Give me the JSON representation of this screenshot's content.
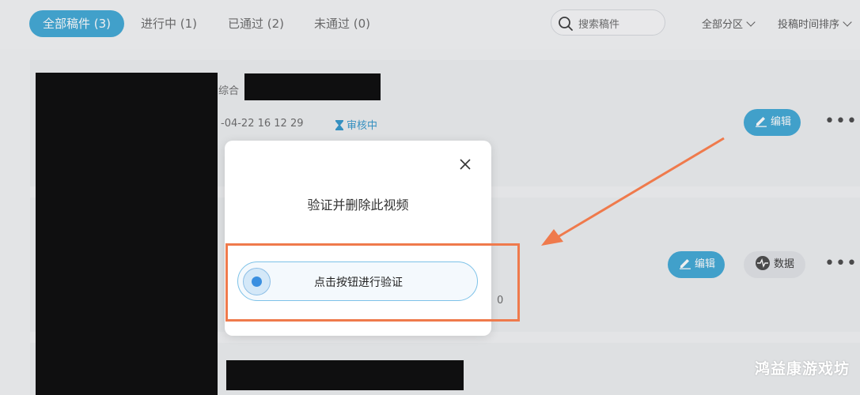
{
  "tabs": [
    {
      "label": "全部稿件 (3)",
      "active": true
    },
    {
      "label": "进行中 (1)",
      "active": false
    },
    {
      "label": "已通过 (2)",
      "active": false
    },
    {
      "label": "未通过 (0)",
      "active": false
    }
  ],
  "search": {
    "placeholder": "搜索稿件"
  },
  "filters": {
    "partition": "全部分区",
    "sort": "投稿时间排序"
  },
  "items": [
    {
      "partial_label": "综合",
      "partial_time": "-04-22 16 12 29",
      "status": "审核中",
      "edit_label": "编辑",
      "more_label": "•••"
    },
    {
      "edit_label": "编辑",
      "data_label": "数据",
      "more_label": "•••",
      "partial_count": "0"
    }
  ],
  "modal": {
    "title": "验证并删除此视频",
    "verify_button": "点击按钮进行验证"
  },
  "colors": {
    "accent": "#3aa5d4",
    "highlight": "#ef7a4c"
  },
  "watermark": "鸿益康游戏坊"
}
